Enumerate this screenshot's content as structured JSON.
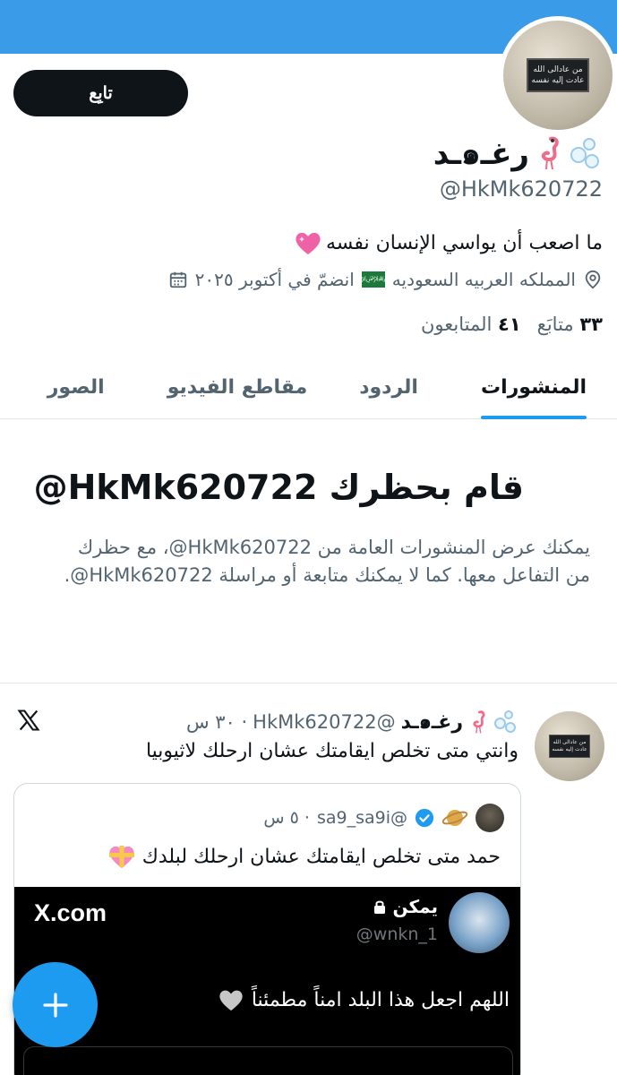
{
  "profile": {
    "follow_label": "تابِع",
    "display_name": "رغـ๑ـد",
    "handle": "@HkMk620722",
    "bio": "ما اصعب أن يواسي الإنسان نفسه",
    "location": "المملكه العربيه السعوديه",
    "joined": "انضمّ في أكتوبر ٢٠٢٥",
    "avatar_sign_line1": "من عادالى الله",
    "avatar_sign_line2": "عادت إليه نفسه",
    "following_count": "٣٣",
    "following_label": "متابَع",
    "followers_count": "٤١",
    "followers_label": "المتابعون"
  },
  "tabs": [
    {
      "label": "المنشورات",
      "active": true
    },
    {
      "label": "الردود",
      "active": false
    },
    {
      "label": "مقاطع الفيديو",
      "active": false
    },
    {
      "label": "الصور",
      "active": false
    }
  ],
  "blocked": {
    "title": "قام بحظرك HkMk620722@",
    "description": "يمكنك عرض المنشورات العامة من HkMk620722@، مع حظرك من التفاعل معها. كما لا يمكنك متابعة أو مراسلة HkMk620722@."
  },
  "post": {
    "author_name": "رغـ๑ـد",
    "author_handle": "@HkMk620722",
    "time": "· ٣٠ س",
    "text": "وانتي متى تخلص ايقامتك عشان ارحلك لاثيوبيا",
    "quote": {
      "handle": "@sa9_sa9i",
      "time": "· ٥ س",
      "text": "حمد متى تخلص ايقامتك عشان ارحلك لبلدك",
      "media": {
        "logo": "X.com",
        "name": "يمكن",
        "handle": "@wnkn_1",
        "text": "اللهم اجعل هذا البلد امناً مطمئناً"
      }
    }
  },
  "colors": {
    "accent": "#1d9bf0",
    "banner": "#3a9ce8",
    "text_primary": "#0f1419",
    "text_secondary": "#536471"
  }
}
